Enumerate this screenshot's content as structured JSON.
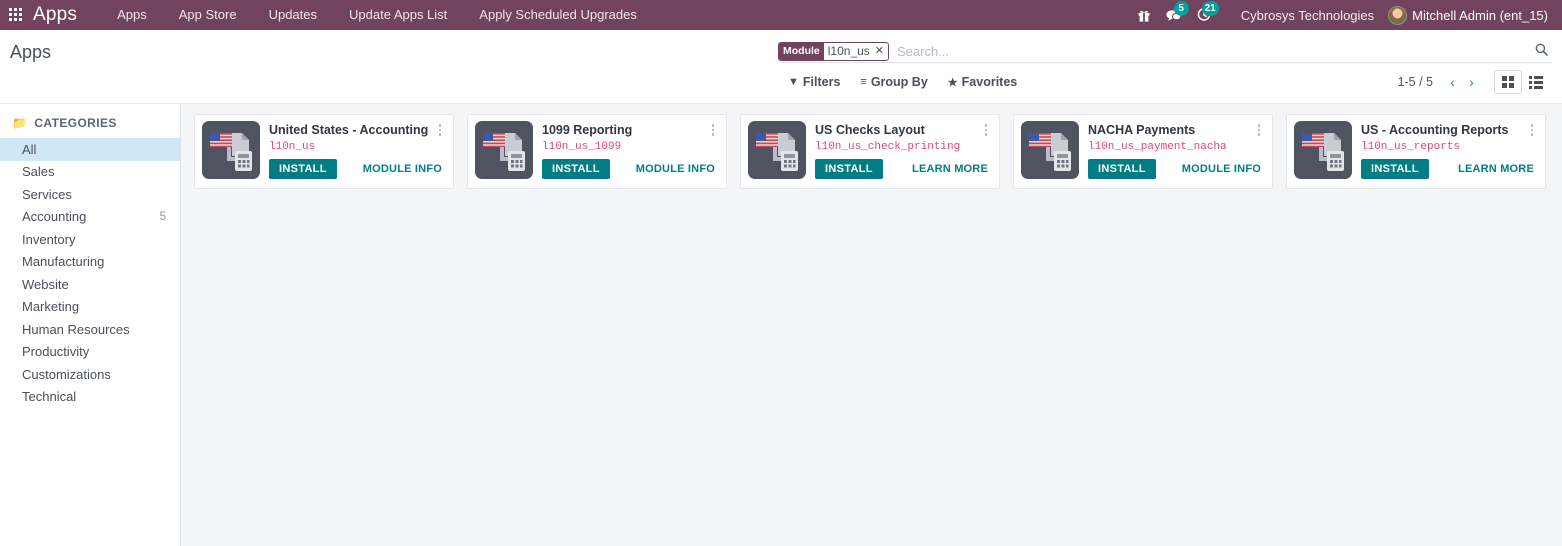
{
  "navbar": {
    "apps_menu_icon": "grid-icon",
    "brand": "Apps",
    "menu_items": [
      {
        "label": "Apps"
      },
      {
        "label": "App Store"
      },
      {
        "label": "Updates"
      },
      {
        "label": "Update Apps List"
      },
      {
        "label": "Apply Scheduled Upgrades"
      }
    ],
    "systray": {
      "gift_icon": "gift-icon",
      "messages_icon": "messages-icon",
      "messages_count": "5",
      "activities_icon": "activity-clock-icon",
      "activities_count": "21"
    },
    "company": "Cybrosys Technologies",
    "user": "Mitchell Admin (ent_15)",
    "accent_bg": "#71435f",
    "badge_color": "#00a09d"
  },
  "control_panel": {
    "breadcrumb": "Apps",
    "search": {
      "facet_label": "Module",
      "facet_value": "l10n_us",
      "facet_close": "✕",
      "placeholder": "Search...",
      "value": "",
      "search_icon": "search-icon"
    },
    "buttons": [
      {
        "label": "Filters",
        "icon": "filter-icon",
        "glyph": "▼"
      },
      {
        "label": "Group By",
        "icon": "group-by-icon",
        "glyph": "≡"
      },
      {
        "label": "Favorites",
        "icon": "star-icon",
        "glyph": "★"
      }
    ],
    "pager": {
      "text": "1-5 / 5",
      "prev_icon": "chevron-left-icon",
      "prev_glyph": "‹",
      "next_icon": "chevron-right-icon",
      "next_glyph": "›"
    },
    "views": [
      {
        "name": "kanban",
        "icon": "kanban-view-icon",
        "active": true
      },
      {
        "name": "list",
        "icon": "list-view-icon",
        "active": false
      }
    ]
  },
  "sidebar": {
    "header": "CATEGORIES",
    "header_icon": "folder-icon",
    "items": [
      {
        "label": "All",
        "count": "",
        "active": true
      },
      {
        "label": "Sales",
        "count": "",
        "active": false
      },
      {
        "label": "Services",
        "count": "",
        "active": false
      },
      {
        "label": "Accounting",
        "count": "5",
        "active": false
      },
      {
        "label": "Inventory",
        "count": "",
        "active": false
      },
      {
        "label": "Manufacturing",
        "count": "",
        "active": false
      },
      {
        "label": "Website",
        "count": "",
        "active": false
      },
      {
        "label": "Marketing",
        "count": "",
        "active": false
      },
      {
        "label": "Human Resources",
        "count": "",
        "active": false
      },
      {
        "label": "Productivity",
        "count": "",
        "active": false
      },
      {
        "label": "Customizations",
        "count": "",
        "active": false
      },
      {
        "label": "Technical",
        "count": "",
        "active": false
      }
    ]
  },
  "apps": [
    {
      "title": "United States - Accounting",
      "technical_name": "l10n_us",
      "install_label": "INSTALL",
      "info_label": "MODULE INFO",
      "icon": "us-accounting-module-icon"
    },
    {
      "title": "1099 Reporting",
      "technical_name": "l10n_us_1099",
      "install_label": "INSTALL",
      "info_label": "MODULE INFO",
      "icon": "us-accounting-module-icon"
    },
    {
      "title": "US Checks Layout",
      "technical_name": "l10n_us_check_printing",
      "install_label": "INSTALL",
      "info_label": "LEARN MORE",
      "icon": "us-accounting-module-icon"
    },
    {
      "title": "NACHA Payments",
      "technical_name": "l10n_us_payment_nacha",
      "install_label": "INSTALL",
      "info_label": "MODULE INFO",
      "icon": "us-accounting-module-icon"
    },
    {
      "title": "US - Accounting Reports",
      "technical_name": "l10n_us_reports",
      "install_label": "INSTALL",
      "info_label": "LEARN MORE",
      "icon": "us-accounting-module-icon"
    }
  ],
  "colors": {
    "primary": "#71435f",
    "teal": "#017e84",
    "tech_name": "#e5457f",
    "selected_row": "#cfe7f7",
    "content_bg": "#f4f5f7"
  }
}
